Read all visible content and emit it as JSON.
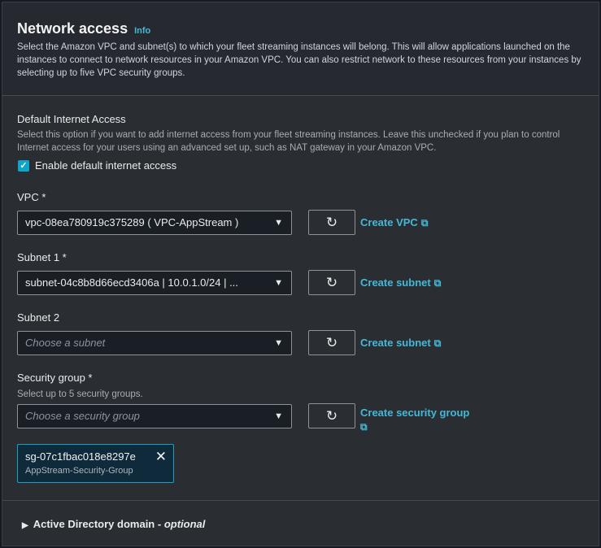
{
  "header": {
    "title": "Network access",
    "info": "Info",
    "description": "Select the Amazon VPC and subnet(s) to which your fleet streaming instances will belong. This will allow applications launched on the instances to connect to network resources in your Amazon VPC. You can also restrict network to these resources from your instances by selecting up to five VPC security groups."
  },
  "internet": {
    "label": "Default Internet Access",
    "description": "Select this option if you want to add internet access from your fleet streaming instances. Leave this unchecked if you plan to control Internet access for your users using an advanced set up, such as NAT gateway in your Amazon VPC.",
    "checkbox_label": "Enable default internet access",
    "checked": true
  },
  "vpc": {
    "label": "VPC *",
    "value": "vpc-08ea780919c375289 ( VPC-AppStream )",
    "link": "Create VPC"
  },
  "subnet1": {
    "label": "Subnet 1 *",
    "value": "subnet-04c8b8d66ecd3406a | 10.0.1.0/24 | ...",
    "link": "Create subnet"
  },
  "subnet2": {
    "label": "Subnet 2",
    "placeholder": "Choose a subnet",
    "link": "Create subnet"
  },
  "security": {
    "label": "Security group *",
    "description": "Select up to 5 security groups.",
    "placeholder": "Choose a security group",
    "link": "Create security group",
    "token": {
      "id": "sg-07c1fbac018e8297e",
      "name": "AppStream-Security-Group"
    }
  },
  "active_directory": {
    "label": "Active Directory domain - ",
    "optional": "optional"
  },
  "colors": {
    "accent": "#44b9d6",
    "checkbox": "#0ea5c9"
  }
}
